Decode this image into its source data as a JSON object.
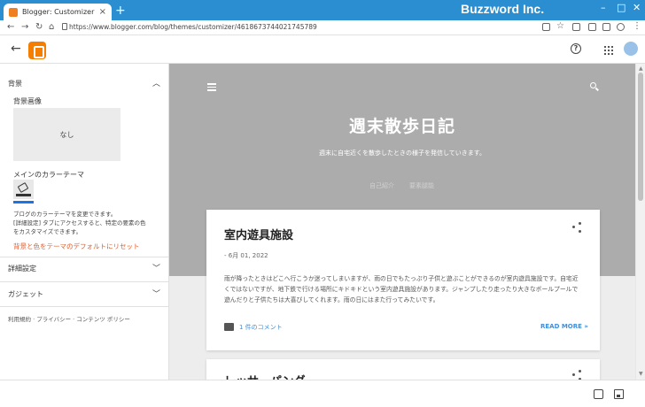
{
  "browser": {
    "tab_title": "Blogger: Customizer",
    "tab_close": "×",
    "new_tab": "+",
    "brand": "Buzzword Inc.",
    "url": "https://www.blogger.com/blog/themes/customizer/4618673744021745789"
  },
  "sidebar": {
    "background_section": "背景",
    "background_image_label": "背景画像",
    "background_image_value": "なし",
    "main_color_theme_label": "メインのカラーテーマ",
    "desc_line1": "ブログのカラーテーマを変更できます。",
    "desc_line2": "[詳細設定] タブにアクセスすると、特定の要素の色",
    "desc_line3": "をカスタマイズできます。",
    "reset_link": "背景と色をテーマのデフォルトにリセット",
    "advanced_section": "詳細設定",
    "gadget_section": "ガジェット",
    "footer_links": "利用規約 · プライバシー · コンテンツ ポリシー"
  },
  "preview": {
    "blog_title": "週末散歩日記",
    "blog_description": "週末に自宅近くを散歩したときの様子を発信していきます。",
    "nav_items": [
      "自己紹介",
      "要素腿能"
    ],
    "post": {
      "title": "室内遊具施設",
      "date": "- 6月 01, 2022",
      "body": "雨が降ったときはどこへ行こうか迷ってしまいますが、雨の日でもたっぷり子供と遊ぶことができるのが室内遊具施設です。自宅近くではないですが、地下鉄で行ける場所にキドキドという室内遊具施設があります。ジャンプしたり走ったり大きなボールプールで遊んだりと子供たちは大喜びしてくれます。雨の日にはまた行ってみたいです。",
      "comments": "1 件のコメント",
      "read_more": "READ MORE »"
    },
    "post2_title": "レッサーパンダ"
  },
  "colors": {
    "titlebar": "#2b8ed0",
    "accent": "#1a73e8",
    "reset_link": "#e25c2b",
    "link": "#3f8fdf",
    "hero_bg": "#acacac"
  }
}
